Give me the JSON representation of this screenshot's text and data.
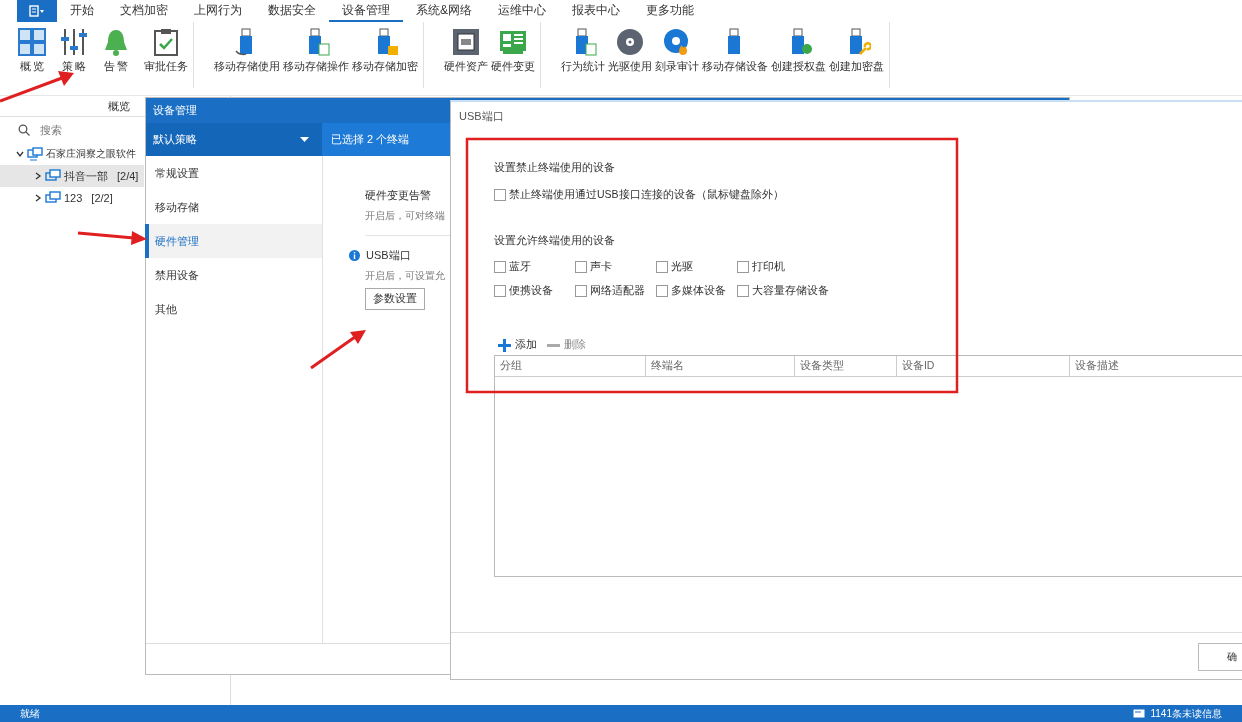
{
  "menu_bar": {
    "tabs": [
      {
        "label": "开始",
        "selected": false
      },
      {
        "label": "文档加密",
        "selected": false
      },
      {
        "label": "上网行为",
        "selected": false
      },
      {
        "label": "数据安全",
        "selected": false
      },
      {
        "label": "设备管理",
        "selected": true
      },
      {
        "label": "系统&网络",
        "selected": false
      },
      {
        "label": "运维中心",
        "selected": false
      },
      {
        "label": "报表中心",
        "selected": false
      },
      {
        "label": "更多功能",
        "selected": false
      }
    ]
  },
  "ribbon": {
    "groups": [
      {
        "items": [
          {
            "label": "概 览",
            "kind": "grid"
          },
          {
            "label": "策 略",
            "kind": "sliders"
          },
          {
            "label": "告 警",
            "kind": "bell"
          },
          {
            "label": "审批任务",
            "kind": "clipboard"
          }
        ]
      },
      {
        "items": [
          {
            "label": "移动存储使用",
            "kind": "usb-cable"
          },
          {
            "label": "移动存储操作",
            "kind": "usb-sheet"
          },
          {
            "label": "移动存储加密",
            "kind": "usb-lock"
          }
        ]
      },
      {
        "items": [
          {
            "label": "硬件资产",
            "kind": "chip"
          },
          {
            "label": "硬件变更",
            "kind": "board"
          }
        ]
      },
      {
        "items": [
          {
            "label": "行为统计",
            "kind": "usb-sheet"
          },
          {
            "label": "光驱使用",
            "kind": "disc"
          },
          {
            "label": "刻录审计",
            "kind": "disc-fire"
          },
          {
            "label": "移动存储设备",
            "kind": "usb"
          },
          {
            "label": "创建授权盘",
            "kind": "usb-badge"
          },
          {
            "label": "创建加密盘",
            "kind": "usb-key"
          }
        ]
      }
    ]
  },
  "left_panel": {
    "title": "概览",
    "search": {
      "placeholder": "搜索"
    },
    "tree": [
      {
        "label": "石家庄洞察之眼软件",
        "selected": false,
        "expanded": true,
        "children": [
          {
            "label": "抖音一部",
            "count": "[2/4]",
            "selected": true,
            "expanded": false
          },
          {
            "label": "123",
            "count": "[2/2]",
            "selected": false,
            "expanded": false
          }
        ]
      }
    ]
  },
  "policy_dialog": {
    "title": "设备管理",
    "policy": "默认策略",
    "selection": "已选择 2 个终端",
    "nav": [
      {
        "label": "常规设置",
        "selected": false
      },
      {
        "label": "移动存储",
        "selected": false
      },
      {
        "label": "硬件管理",
        "selected": true
      },
      {
        "label": "禁用设备",
        "selected": false
      },
      {
        "label": "其他",
        "selected": false
      }
    ],
    "settings": [
      {
        "kind": "plain",
        "title": "硬件变更告警",
        "description": "开启后，可对终端"
      },
      {
        "kind": "info",
        "title": "USB端口",
        "description": "开启后，可设置允",
        "button": "参数设置"
      }
    ]
  },
  "usb_dialog": {
    "title": "USB端口",
    "block_section": {
      "title": "设置禁止终端使用的设备",
      "option": {
        "label": "禁止终端使用通过USB接口连接的设备（鼠标键盘除外）",
        "checked": false
      }
    },
    "allow_section": {
      "title": "设置允许终端使用的设备",
      "options": [
        {
          "label": "蓝牙",
          "checked": false
        },
        {
          "label": "声卡",
          "checked": false
        },
        {
          "label": "光驱",
          "checked": false
        },
        {
          "label": "打印机",
          "checked": false
        },
        {
          "label": "便携设备",
          "checked": false
        },
        {
          "label": "网络适配器",
          "checked": false
        },
        {
          "label": "多媒体设备",
          "checked": false
        },
        {
          "label": "大容量存储设备",
          "checked": false
        }
      ]
    },
    "toolbar": {
      "add": "添加",
      "remove": "删除"
    },
    "table": {
      "columns": [
        "分组",
        "终端名",
        "设备类型",
        "设备ID",
        "设备描述"
      ]
    },
    "buttons": [
      "确"
    ]
  },
  "status_bar": {
    "status": "就绪",
    "messages": "1141条未读信息"
  }
}
